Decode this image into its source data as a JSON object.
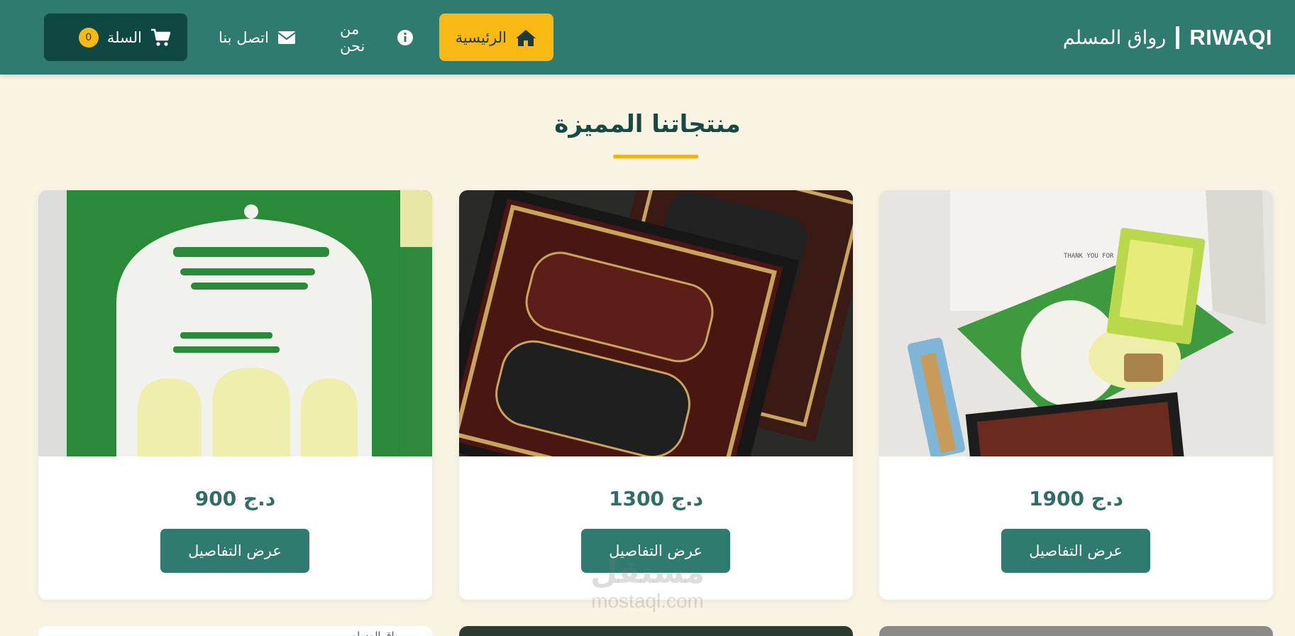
{
  "header": {
    "brand_en": "RIWAQI",
    "brand_ar": "رواق المسلم",
    "nav": {
      "home": "الرئيسية",
      "about": "من نحن",
      "contact": "اتصل بنا",
      "cart": "السلة",
      "cart_count": "0"
    }
  },
  "section": {
    "title": "منتجاتنا المميزة"
  },
  "products": [
    {
      "price": "1900 د.ج",
      "button": "عرض التفاصيل",
      "image_label": "THANK YOU FOR CHOOSING US"
    },
    {
      "price": "1300 د.ج",
      "button": "عرض التفاصيل"
    },
    {
      "price": "900 د.ج",
      "button": "عرض التفاصيل"
    }
  ],
  "next_row": {
    "broken_image_alt": "رواق المسلم"
  },
  "watermark": {
    "ar": "مستقل",
    "en": "mostaql.com"
  },
  "colors": {
    "header": "#2f7b6f",
    "accent": "#f8b914",
    "cart": "#0f4843",
    "background": "#f9f3e3",
    "button": "#2f7b6f"
  }
}
